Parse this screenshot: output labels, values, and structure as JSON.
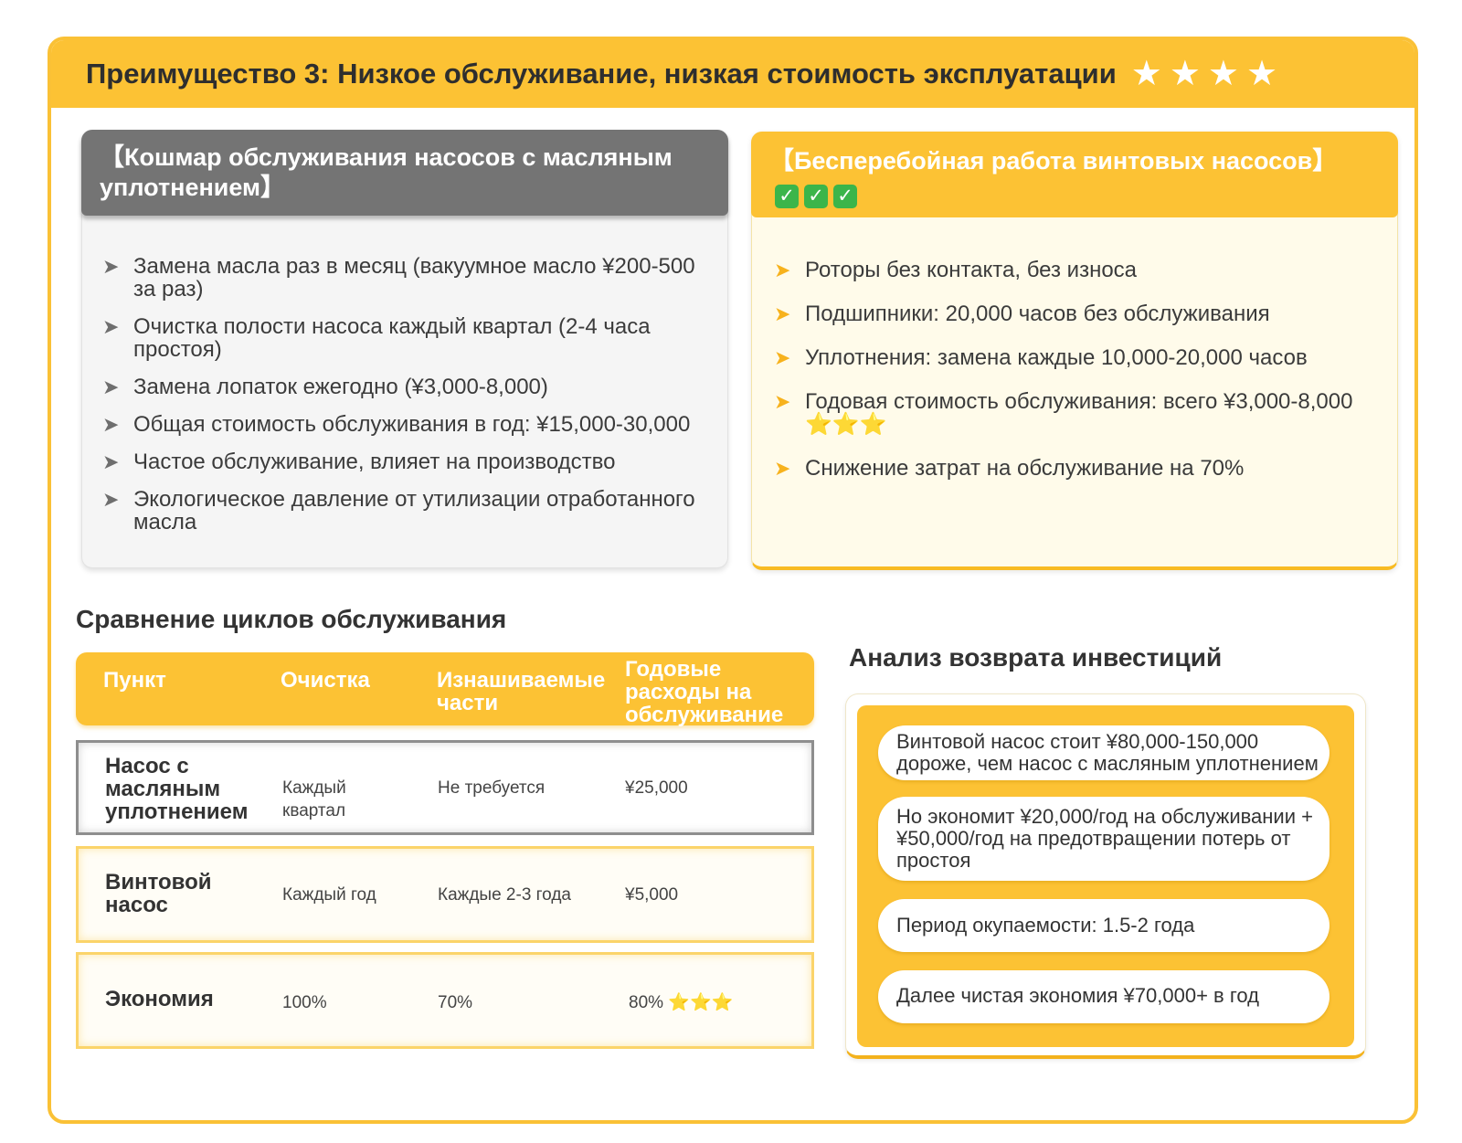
{
  "header": {
    "title": "Преимущество 3: Низкое обслуживание, низкая стоимость эксплуатации",
    "stars": "★★★★"
  },
  "oil_pump": {
    "title": "【Кошмар обслуживания насосов с масляным уплотнением】",
    "bullet": "➤",
    "items": [
      "Замена масла раз в месяц (вакуумное масло ¥200-500 за раз)",
      "Очистка полости насоса каждый квартал (2-4 часа простоя)",
      "Замена лопаток ежегодно (¥3,000-8,000)",
      "Общая стоимость обслуживания в год: ¥15,000-30,000",
      "Частое обслуживание, влияет на производство",
      "Экологическое давление от утилизации отработанного масла"
    ]
  },
  "screw_pump": {
    "title": "【Бесперебойная работа винтовых насосов】",
    "checks": [
      "✓",
      "✓",
      "✓"
    ],
    "bullet": "➤",
    "items": [
      "Роторы без контакта, без износа",
      "Подшипники: 20,000 часов без обслуживания",
      "Уплотнения: замена каждые 10,000-20,000 часов",
      "Годовая стоимость обслуживания: всего ¥3,000-8,000",
      "Снижение затрат на обслуживание на 70%"
    ],
    "item4_stars": "⭐⭐⭐"
  },
  "comparison": {
    "title": "Сравнение циклов обслуживания",
    "headers": [
      "Пункт",
      "Очистка",
      "Изнашиваемые части",
      "Годовые расходы на обслуживание"
    ],
    "rows": [
      {
        "name": "Насос с масляным уплотнением",
        "cleaning": "Каждый квартал",
        "parts": "Не требуется",
        "cost": "¥25,000",
        "stars": ""
      },
      {
        "name": "Винтовой насос",
        "cleaning": "Каждый год",
        "parts": "Каждые 2-3 года",
        "cost": "¥5,000",
        "stars": ""
      },
      {
        "name": "Экономия",
        "cleaning": "100%",
        "parts": "70%",
        "cost": "80%",
        "stars": "⭐⭐⭐"
      }
    ]
  },
  "roi": {
    "title": "Анализ возврата инвестиций",
    "items": [
      "Винтовой насос стоит ¥80,000-150,000 дороже, чем насос с масляным уплотнением",
      "Но экономит ¥20,000/год на обслуживании + ¥50,000/год на предотвращении потерь от простоя",
      "Период окупаемости: 1.5-2 года",
      "Далее чистая экономия ¥70,000+ в год"
    ]
  },
  "colors": {
    "accent": "#fcc234",
    "gray_header": "#747474",
    "check_green": "#3bb54a"
  }
}
